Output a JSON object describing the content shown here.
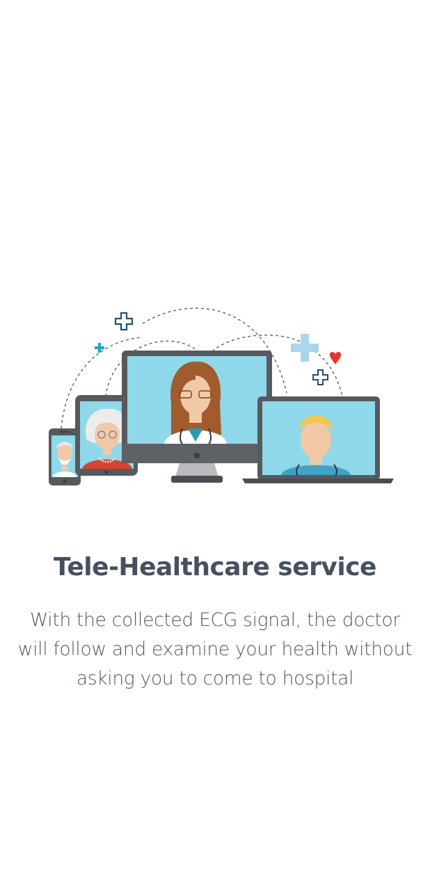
{
  "onboarding": {
    "title": "Tele-Healthcare service",
    "description_lines": [
      "With the collected ECG signal, the doctor",
      "will follow and examine your health without",
      "asking you to come to hospital"
    ],
    "illustration": {
      "icons": [
        "phone-patient",
        "tablet-patient",
        "monitor-doctor",
        "laptop-doctor",
        "medical-cross-icon",
        "heart-icon"
      ],
      "colors": {
        "screen": "#8fd8ea",
        "device_frame": "#56595e",
        "cross_dark": "#1e4f6e",
        "cross_teal": "#1aa9c5",
        "cross_light": "#a9d6ec",
        "heart": "#e8342c",
        "text_dark": "#46505f"
      }
    }
  }
}
